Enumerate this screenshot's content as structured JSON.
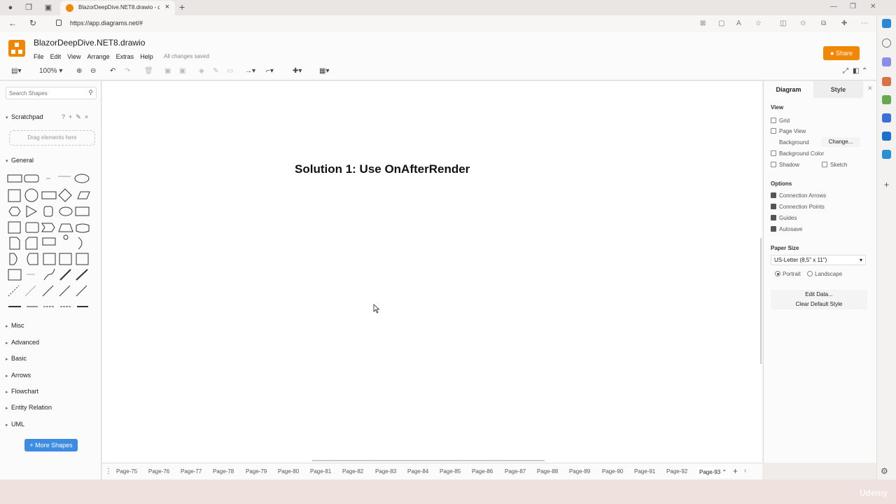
{
  "browser": {
    "tab_title": "BlazorDeepDive.NET8.drawio - d",
    "url": "https://app.diagrams.net/#"
  },
  "app": {
    "doc_title": "BlazorDeepDive.NET8.drawio",
    "menu": [
      "File",
      "Edit",
      "View",
      "Arrange",
      "Extras",
      "Help"
    ],
    "save_status": "All changes saved",
    "share_label": "Share",
    "accent": "#f08705"
  },
  "toolbar": {
    "zoom": "100%"
  },
  "left_panel": {
    "search_placeholder": "Search Shapes",
    "scratchpad_title": "Scratchpad",
    "drop_hint": "Drag elements here",
    "general_title": "General",
    "libraries": [
      "Misc",
      "Advanced",
      "Basic",
      "Arrows",
      "Flowchart",
      "Entity Relation",
      "UML"
    ],
    "more_shapes": "+ More Shapes"
  },
  "canvas": {
    "text": "Solution 1: Use OnAfterRender"
  },
  "format_panel": {
    "tabs": [
      "Diagram",
      "Style"
    ],
    "view_title": "View",
    "grid": "Grid",
    "page_view": "Page View",
    "background": "Background",
    "change": "Change...",
    "background_color": "Background Color",
    "shadow": "Shadow",
    "sketch": "Sketch",
    "options_title": "Options",
    "connection_arrows": "Connection Arrows",
    "connection_points": "Connection Points",
    "guides": "Guides",
    "autosave": "Autosave",
    "paper_size_title": "Paper Size",
    "paper_size": "US-Letter (8,5\" x 11\")",
    "portrait": "Portrait",
    "landscape": "Landscape",
    "edit_data": "Edit Data...",
    "clear_default_style": "Clear Default Style"
  },
  "pages": [
    "Page-75",
    "Page-76",
    "Page-77",
    "Page-78",
    "Page-79",
    "Page-80",
    "Page-81",
    "Page-82",
    "Page-83",
    "Page-84",
    "Page-85",
    "Page-86",
    "Page-87",
    "Page-88",
    "Page-89",
    "Page-90",
    "Page-91",
    "Page-92",
    "Page-93"
  ],
  "active_page": "Page-93",
  "watermark": "Udemy"
}
